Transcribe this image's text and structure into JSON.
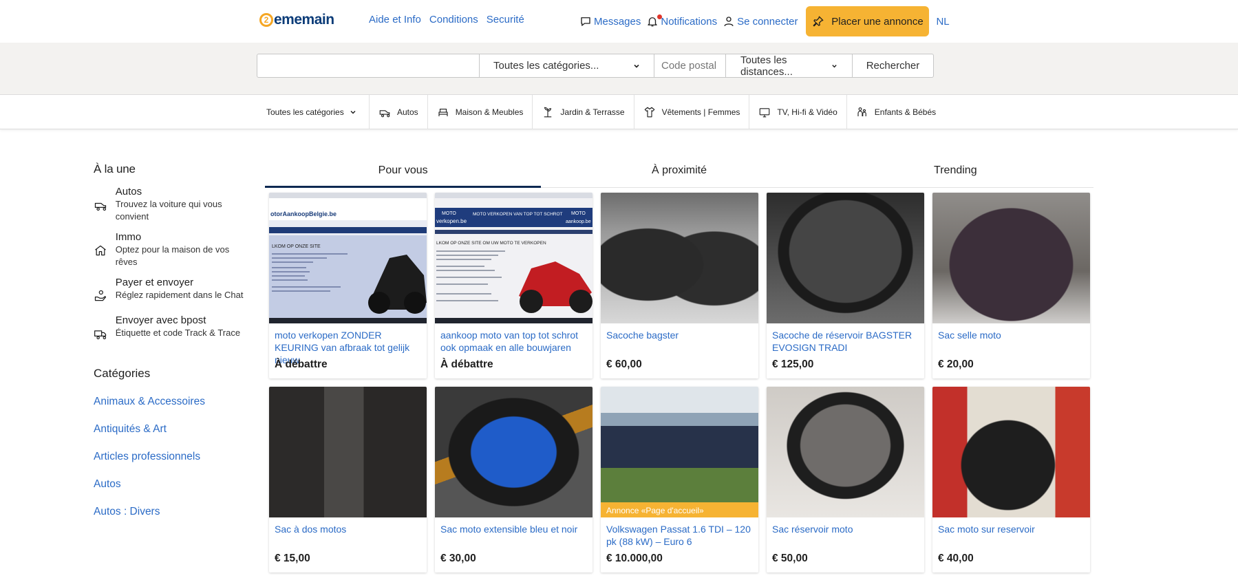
{
  "header": {
    "logo_mark": "2",
    "logo_text": "ememain",
    "links": [
      "Aide et Info",
      "Conditions",
      "Securité"
    ],
    "messages": "Messages",
    "notifications": "Notifications",
    "login": "Se connecter",
    "place_ad": "Placer une annonce",
    "lang": "NL"
  },
  "search": {
    "query": "",
    "category": "Toutes les catégories...",
    "postal_placeholder": "Code postal",
    "distance": "Toutes les distances...",
    "submit": "Rechercher"
  },
  "catbar": {
    "all": "Toutes les catégories",
    "items": [
      {
        "label": "Autos",
        "icon": "car-icon"
      },
      {
        "label": "Maison & Meubles",
        "icon": "furniture-icon"
      },
      {
        "label": "Jardin & Terrasse",
        "icon": "garden-icon"
      },
      {
        "label": "Vêtements | Femmes",
        "icon": "clothing-icon"
      },
      {
        "label": "TV, Hi-fi & Vidéo",
        "icon": "tv-icon"
      },
      {
        "label": "Enfants & Bébés",
        "icon": "kids-icon"
      }
    ]
  },
  "sidebar": {
    "featured_title": "À la une",
    "featured": [
      {
        "title": "Autos",
        "sub": "Trouvez la voiture qui vous convient",
        "icon": "car-icon"
      },
      {
        "title": "Immo",
        "sub": "Optez pour la maison de vos rêves",
        "icon": "house-icon"
      },
      {
        "title": "Payer et envoyer",
        "sub": "Réglez rapidement dans le Chat",
        "icon": "hand-pay-icon"
      },
      {
        "title": "Envoyer avec bpost",
        "sub": "Étiquette et code Track & Trace",
        "icon": "delivery-truck-icon"
      }
    ],
    "categories_title": "Catégories",
    "categories": [
      "Animaux & Accessoires",
      "Antiquités & Art",
      "Articles professionnels",
      "Autos",
      "Autos : Divers"
    ]
  },
  "tabs": [
    "Pour vous",
    "À proximité",
    "Trending"
  ],
  "listings": [
    {
      "title": "moto verkopen ZONDER KEURING van afbraak tot gelijk nieuw",
      "price": "À débattre"
    },
    {
      "title": "aankoop moto van top tot schrot ook opmaak en alle bouwjaren",
      "price": "À débattre"
    },
    {
      "title": "Sacoche bagster",
      "price": "€ 60,00"
    },
    {
      "title": "Sacoche de réservoir BAGSTER EVOSIGN TRADI",
      "price": "€ 125,00"
    },
    {
      "title": "Sac selle moto",
      "price": "€ 20,00"
    },
    {
      "title": "Sac à dos motos",
      "price": "€ 15,00"
    },
    {
      "title": "Sac moto extensible bleu et noir",
      "price": "€ 30,00"
    },
    {
      "title": "Volkswagen Passat 1.6 TDI – 120 pk (88 kW) – Euro 6",
      "price": "€ 10.000,00",
      "badge": "Annonce «Page d'accueil»"
    },
    {
      "title": "Sac réservoir moto",
      "price": "€ 50,00"
    },
    {
      "title": "Sac moto sur reservoir",
      "price": "€ 40,00"
    }
  ],
  "site_text": {
    "s1_url": "otorAankoopBelgie.be",
    "s1_heading": "LKOM OP ONZE SITE",
    "s2_brand_top": "MOTO",
    "s2_brand_bottom": "verkopen.be",
    "s2_banner": "MOTO VERKOPEN VAN TOP TOT SCHROT",
    "s2_brand2_top": "MOTO",
    "s2_brand2_bottom": "aankoop.be",
    "s2_heading": "LKOM OP ONZE SITE OM UW MOTO TE VERKOPEN"
  },
  "colors": {
    "accent": "#f6b333",
    "link": "#2b6bc6",
    "brand": "#0c3c78",
    "active_tab": "#0c2851"
  }
}
